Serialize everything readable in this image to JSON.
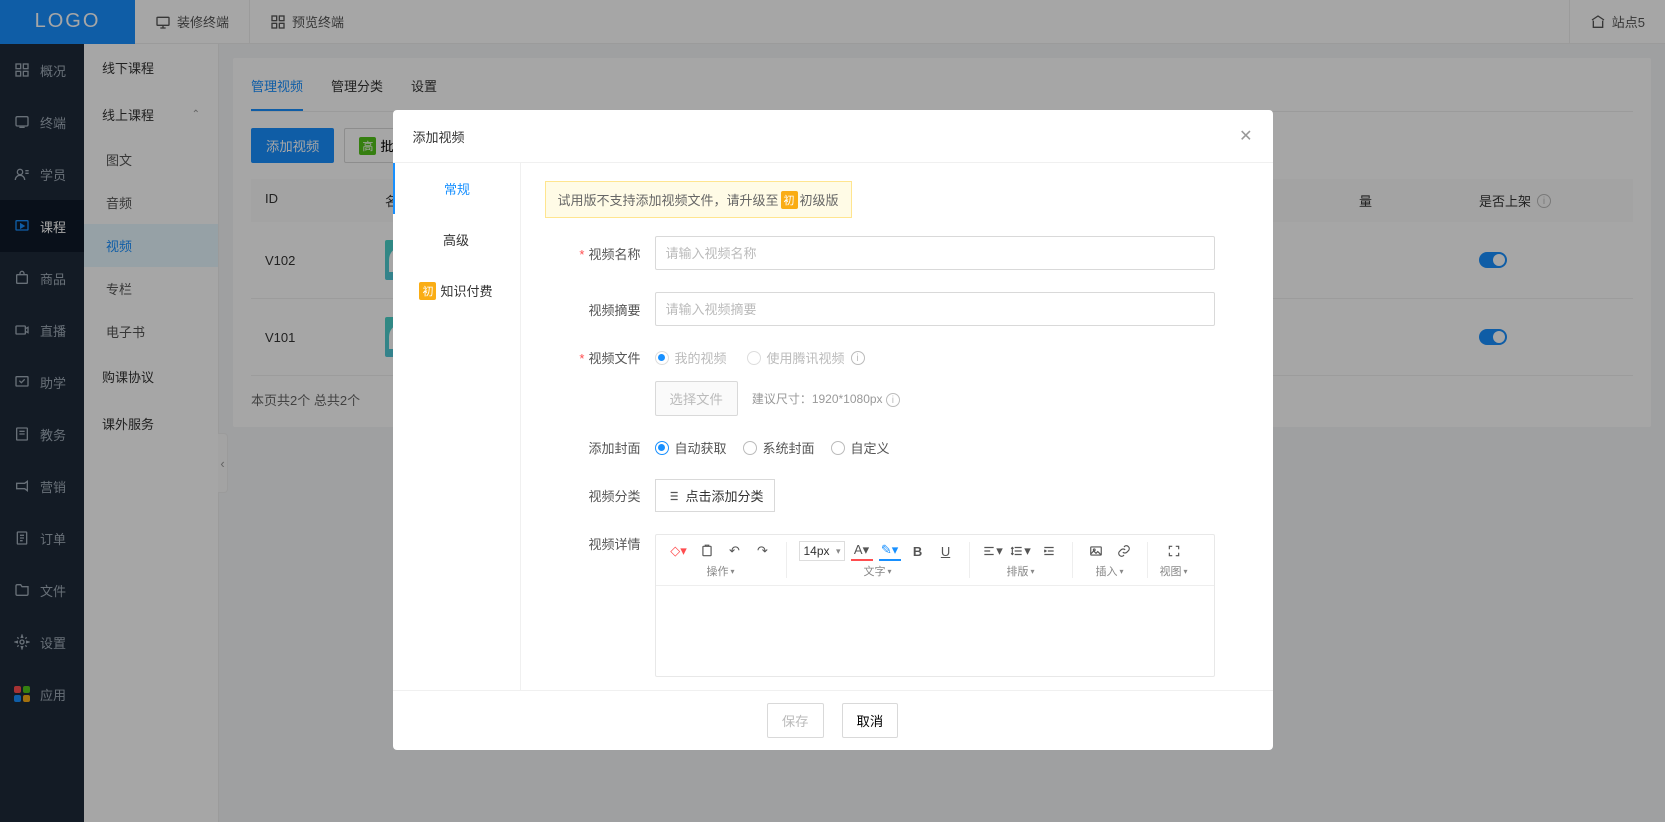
{
  "header": {
    "logo": "LOGO",
    "nav": [
      {
        "label": "装修终端"
      },
      {
        "label": "预览终端"
      }
    ],
    "site": "站点5"
  },
  "leftNav": [
    {
      "label": "概况"
    },
    {
      "label": "终端"
    },
    {
      "label": "学员"
    },
    {
      "label": "课程",
      "active": true
    },
    {
      "label": "商品"
    },
    {
      "label": "直播"
    },
    {
      "label": "助学"
    },
    {
      "label": "教务"
    },
    {
      "label": "营销"
    },
    {
      "label": "订单"
    },
    {
      "label": "文件"
    },
    {
      "label": "设置"
    },
    {
      "label": "应用"
    }
  ],
  "subNav": {
    "group1": "线下课程",
    "group2": "线上课程",
    "items": [
      {
        "label": "图文"
      },
      {
        "label": "音频"
      },
      {
        "label": "视频",
        "active": true
      },
      {
        "label": "专栏"
      },
      {
        "label": "电子书"
      }
    ],
    "group3": "购课协议",
    "group4": "课外服务"
  },
  "tabs": [
    {
      "label": "管理视频",
      "active": true
    },
    {
      "label": "管理分类"
    },
    {
      "label": "设置"
    }
  ],
  "toolbar": {
    "add": "添加视频",
    "batch_badge": "高",
    "batch": "批量添加"
  },
  "table": {
    "cols": {
      "id": "ID",
      "name": "名称",
      "qty": "量",
      "status": "是否上架"
    },
    "rows": [
      {
        "id": "V102"
      },
      {
        "id": "V101"
      }
    ],
    "pager": "本页共2个 总共2个"
  },
  "modal": {
    "title": "添加视频",
    "side": [
      {
        "label": "常规",
        "active": true
      },
      {
        "label": "高级"
      },
      {
        "label": "知识付费",
        "badge": "初"
      }
    ],
    "alert_pre": "试用版不支持添加视频文件，请升级至",
    "alert_badge": "初",
    "alert_post": "初级版",
    "labels": {
      "name": "视频名称",
      "summary": "视频摘要",
      "file": "视频文件",
      "cover": "添加封面",
      "category": "视频分类",
      "detail": "视频详情"
    },
    "placeholders": {
      "name": "请输入视频名称",
      "summary": "请输入视频摘要"
    },
    "file_opts": {
      "mine": "我的视频",
      "tencent": "使用腾讯视频"
    },
    "select_file": "选择文件",
    "size_hint": "建议尺寸：1920*1080px",
    "cover_opts": {
      "auto": "自动获取",
      "system": "系统封面",
      "custom": "自定义"
    },
    "category_btn": "点击添加分类",
    "editor": {
      "font_size": "14px",
      "grp_op": "操作",
      "grp_text": "文字",
      "grp_layout": "排版",
      "grp_insert": "插入",
      "grp_view": "视图"
    },
    "save": "保存",
    "cancel": "取消"
  }
}
